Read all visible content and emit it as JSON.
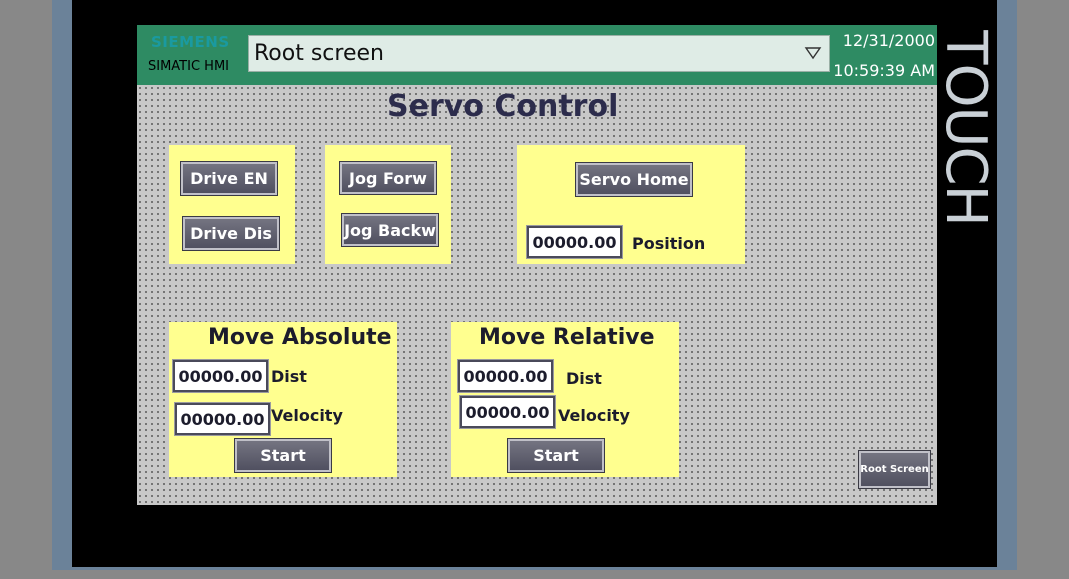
{
  "device": {
    "brand_text": "TOUCH"
  },
  "header": {
    "siemens_logo": "SIEMENS",
    "simatic_logo": "SIMATIC HMI",
    "screen_select": {
      "value": "Root screen",
      "icon": "chevron-down-icon"
    },
    "date": "12/31/2000",
    "time": "10:59:39 AM"
  },
  "screen": {
    "title": "Servo Control",
    "drive_panel": {
      "enable_label": "Drive EN",
      "disable_label": "Drive Dis"
    },
    "jog_panel": {
      "forward_label": "Jog Forw",
      "backward_label": "Jog Backw"
    },
    "home_panel": {
      "home_label": "Servo Home",
      "position_value": "00000.00",
      "position_label": "Position"
    },
    "move_absolute": {
      "title": "Move Absolute",
      "dist_value": "00000.00",
      "dist_label": "Dist",
      "velocity_value": "00000.00",
      "velocity_label": "Velocity",
      "start_label": "Start"
    },
    "move_relative": {
      "title": "Move Relative",
      "dist_value": "00000.00",
      "dist_label": "Dist",
      "velocity_value": "00000.00",
      "velocity_label": "Velocity",
      "start_label": "Start"
    },
    "root_screen_button": "Root Screen"
  },
  "colors": {
    "header": "#2e8b63",
    "panel": "#ffff8f",
    "button": "#5a5a6a",
    "bezel": "#000000"
  }
}
